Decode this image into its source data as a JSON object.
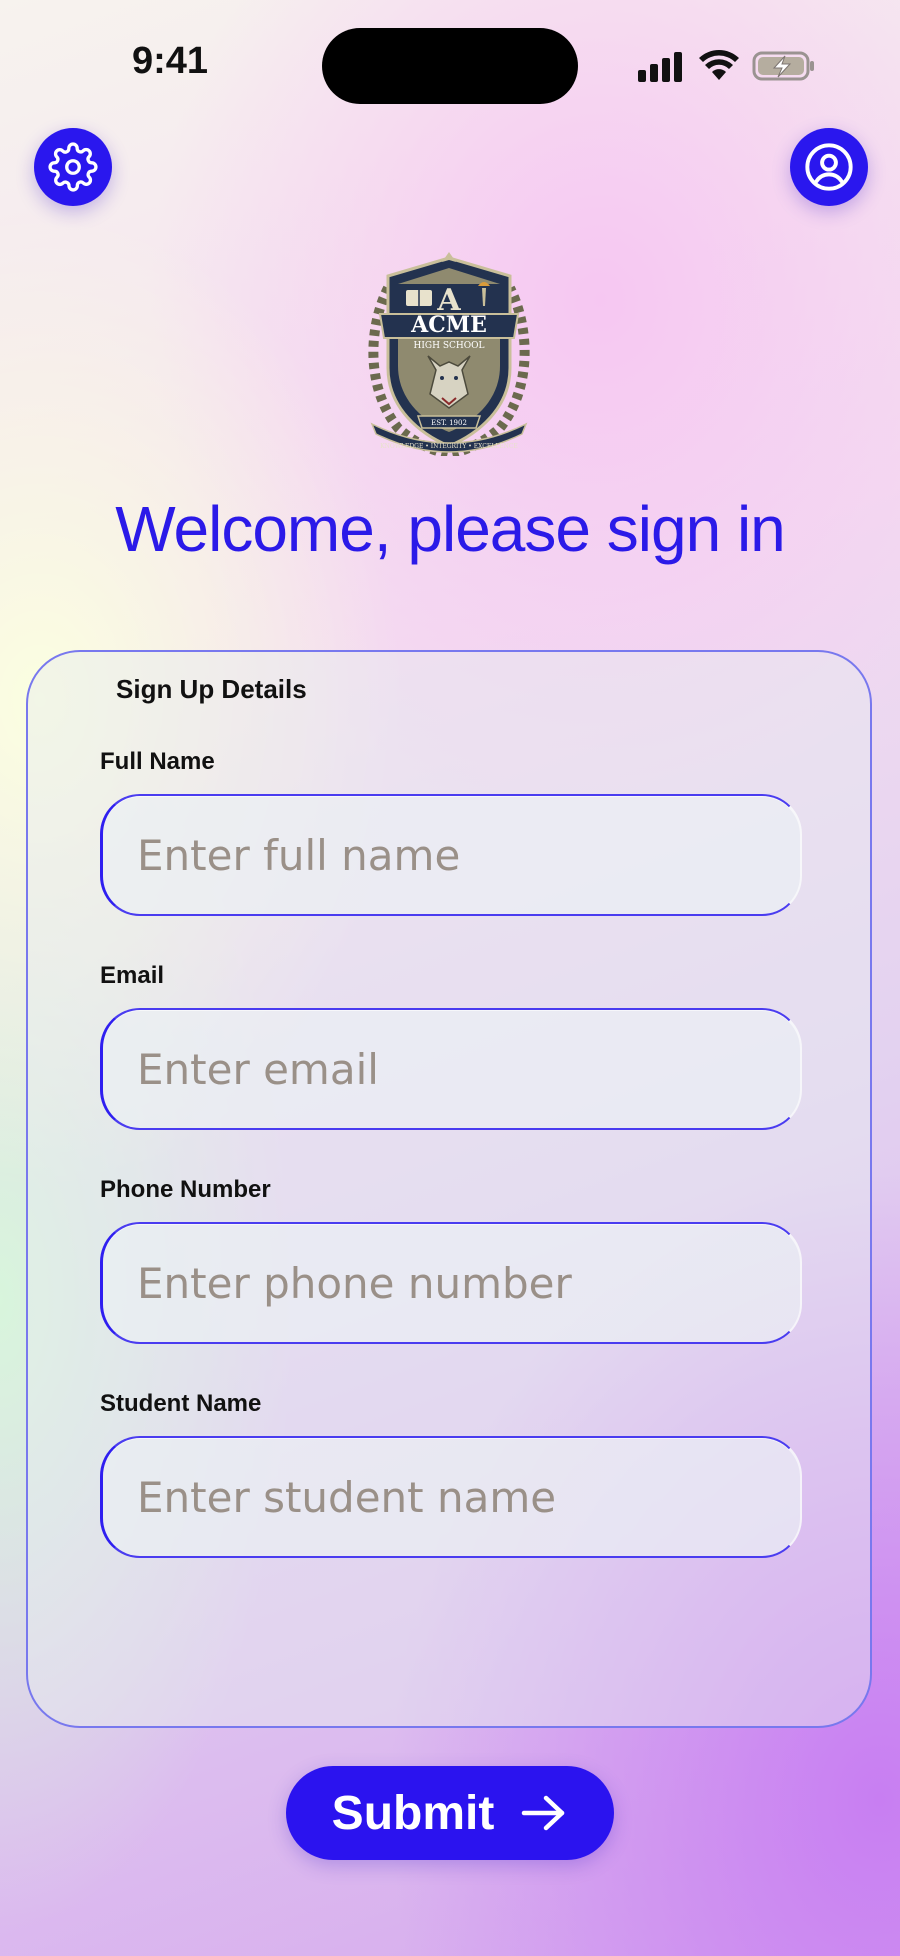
{
  "status_bar": {
    "time": "9:41"
  },
  "header": {
    "settings_icon": "gear-icon",
    "profile_icon": "user-circle-icon"
  },
  "logo": {
    "name": "ACME",
    "subtitle": "HIGH SCHOOL",
    "established": "EST. 1902",
    "motto": "KNOWLEDGE • INTEGRITY • EXCELLENCE"
  },
  "page_title": "Welcome, please sign in",
  "form": {
    "title": "Sign Up Details",
    "fields": [
      {
        "label": "Full Name",
        "placeholder": "Enter full name",
        "value": ""
      },
      {
        "label": "Email",
        "placeholder": "Enter email",
        "value": ""
      },
      {
        "label": "Phone Number",
        "placeholder": "Enter phone number",
        "value": ""
      },
      {
        "label": "Student Name",
        "placeholder": "Enter student name",
        "value": ""
      }
    ]
  },
  "submit": {
    "label": "Submit",
    "icon": "arrow-right-icon"
  },
  "colors": {
    "accent": "#2b13ef",
    "title": "#2b1ae8",
    "card_border": "#7878ee"
  }
}
